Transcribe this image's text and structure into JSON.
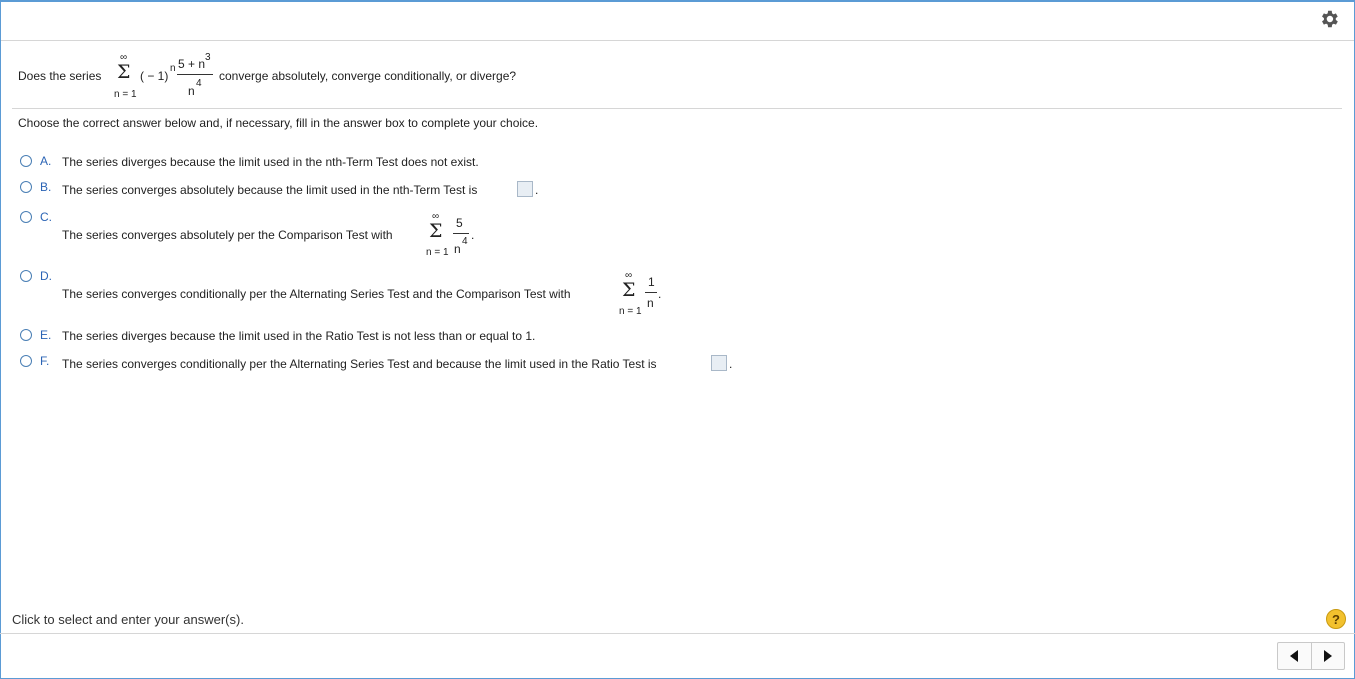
{
  "question": {
    "prefix": "Does the series",
    "sigma": "Σ",
    "upper_limit": "∞",
    "lower_limit": "n = 1",
    "term_base": "( − 1)",
    "term_exp": "n",
    "numerator": "5 + n",
    "numerator_exp": "3",
    "denominator": "n",
    "denominator_exp": "4",
    "suffix": "converge absolutely, converge conditionally, or diverge?"
  },
  "instruction": "Choose the correct answer below and, if necessary, fill in the answer box to complete your choice.",
  "options": {
    "A": {
      "letter": "A.",
      "text": "The series diverges because the limit used in the nth-Term Test does not exist."
    },
    "B": {
      "letter": "B.",
      "text": "The series converges absolutely because the limit used in the nth-Term Test is",
      "end": "."
    },
    "C": {
      "letter": "C.",
      "text": "The series converges absolutely per the Comparison Test with",
      "sigma": "Σ",
      "upper": "∞",
      "lower": "n = 1",
      "num": "5",
      "den": "n",
      "den_exp": "4",
      "end": "."
    },
    "D": {
      "letter": "D.",
      "text": "The series converges conditionally per the Alternating Series Test and the Comparison Test with",
      "sigma": "Σ",
      "upper": "∞",
      "lower": "n = 1",
      "num": "1",
      "den": "n",
      "end": "."
    },
    "E": {
      "letter": "E.",
      "text": "The series diverges because the limit used in the Ratio Test is not less than or equal to 1."
    },
    "F": {
      "letter": "F.",
      "text": "The series converges conditionally per the Alternating Series Test and because the limit used in the Ratio Test is",
      "end": "."
    }
  },
  "status_text": "Click to select and enter your answer(s).",
  "help_label": "?",
  "icons": {
    "settings": "gear-icon",
    "help": "help-icon",
    "prev": "arrow-left-icon",
    "next": "arrow-right-icon"
  },
  "colors": {
    "accent": "#5b9bd5",
    "letter": "#2b64b5",
    "help": "#f2c12e"
  }
}
